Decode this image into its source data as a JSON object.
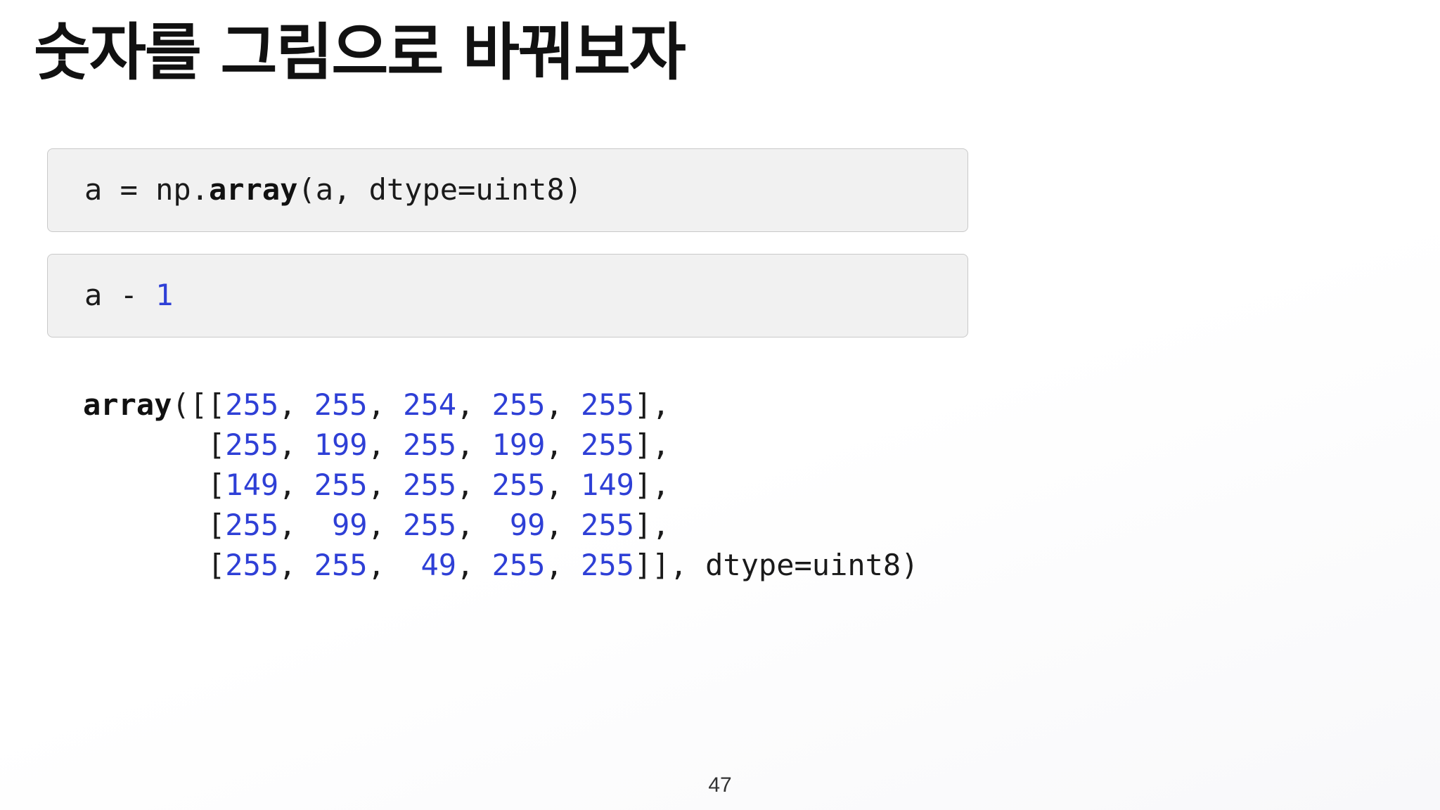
{
  "slide": {
    "title": "숫자를 그림으로 바꿔보자",
    "page_number": "47"
  },
  "cell1": {
    "prefix": "a = np.",
    "keyword": "array",
    "suffix": "(a, dtype=uint8)"
  },
  "cell2": {
    "prefix": "a - ",
    "number": "1"
  },
  "output": {
    "keyword": "array",
    "open": "([[",
    "rows": [
      [
        "255",
        "255",
        "254",
        "255",
        "255"
      ],
      [
        "255",
        "199",
        "255",
        "199",
        "255"
      ],
      [
        "149",
        "255",
        "255",
        "255",
        "149"
      ],
      [
        "255",
        " 99",
        "255",
        " 99",
        "255"
      ],
      [
        "255",
        "255",
        " 49",
        "255",
        "255"
      ]
    ],
    "row_indent": "       [",
    "row_close": "],",
    "last_close": "]], ",
    "dtype": "dtype=uint8)"
  },
  "colors": {
    "number": "#2e3fd6",
    "cell_background": "#f1f1f1",
    "cell_border": "#c9c9c9",
    "text": "#1a1a1a"
  }
}
